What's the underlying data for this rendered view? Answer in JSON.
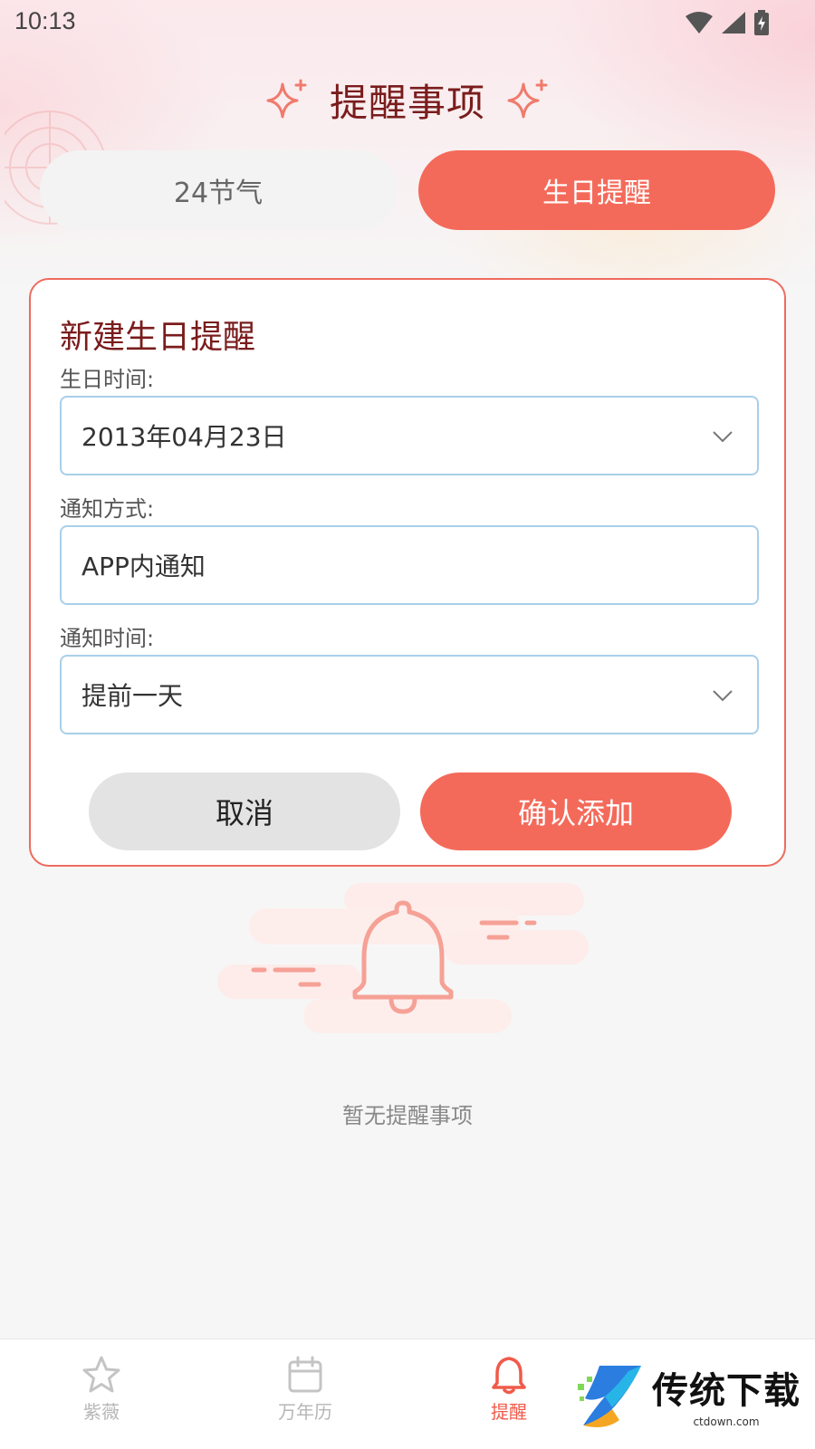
{
  "status_bar": {
    "time": "10:13"
  },
  "header": {
    "title": "提醒事项"
  },
  "tabs": [
    {
      "label": "24节气",
      "active": false
    },
    {
      "label": "生日提醒",
      "active": true
    }
  ],
  "form": {
    "title": "新建生日提醒",
    "birthday_label": "生日时间:",
    "birthday_value": "2013年04月23日",
    "notify_method_label": "通知方式:",
    "notify_method_value": "APP内通知",
    "notify_time_label": "通知时间:",
    "notify_time_value": "提前一天",
    "cancel_label": "取消",
    "confirm_label": "确认添加"
  },
  "empty_state": {
    "text": "暂无提醒事项"
  },
  "bottom_nav": [
    {
      "label": "紫薇",
      "icon": "star-icon",
      "active": false
    },
    {
      "label": "万年历",
      "icon": "calendar-icon",
      "active": false
    },
    {
      "label": "提醒",
      "icon": "bell-icon",
      "active": true
    }
  ],
  "watermark": {
    "title": "传统下载",
    "domain": "ctdown.com"
  },
  "colors": {
    "accent": "#f46a5a",
    "title_dark_red": "#7a1c1c",
    "input_border": "#a9cfe9",
    "inactive_tab": "#f3f3f3"
  }
}
